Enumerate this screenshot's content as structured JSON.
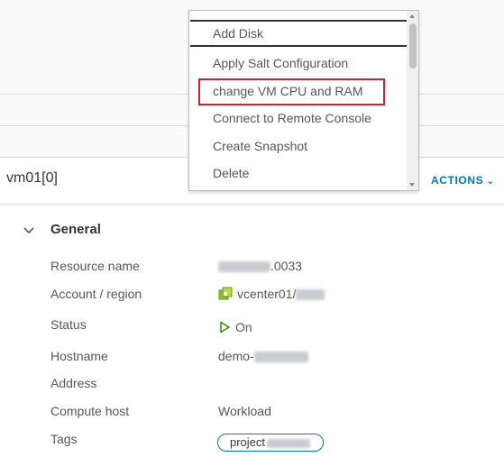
{
  "dropdown": {
    "items": [
      {
        "label": "Add Disk"
      },
      {
        "label": "Apply Salt Configuration"
      },
      {
        "label": "change VM CPU and RAM"
      },
      {
        "label": "Connect to Remote Console"
      },
      {
        "label": "Create Snapshot"
      },
      {
        "label": "Delete"
      }
    ],
    "highlighted_item": "change VM CPU and RAM"
  },
  "header": {
    "vm_title": "vm01[0]",
    "actions_label": "ACTIONS"
  },
  "general": {
    "section_title": "General",
    "properties": [
      {
        "label": "Resource name",
        "value_suffix": ".0033"
      },
      {
        "label": "Account / region",
        "value": "vcenter01/"
      },
      {
        "label": "Status",
        "value": "On"
      },
      {
        "label": "Hostname",
        "value": "demo-"
      },
      {
        "label": "Address",
        "value": ""
      },
      {
        "label": "Compute host",
        "value": "Workload"
      },
      {
        "label": "Tags",
        "value": "project"
      }
    ]
  },
  "colors": {
    "accent": "#0079b8",
    "highlight_border": "#d0202a",
    "status_on": "#3c8500",
    "vcenter_icon": "#8fc31f"
  },
  "icons": {
    "actions": "chevron-down-icon",
    "section": "chevron-down-icon",
    "account": "vcenter-icon",
    "status": "play-icon"
  }
}
